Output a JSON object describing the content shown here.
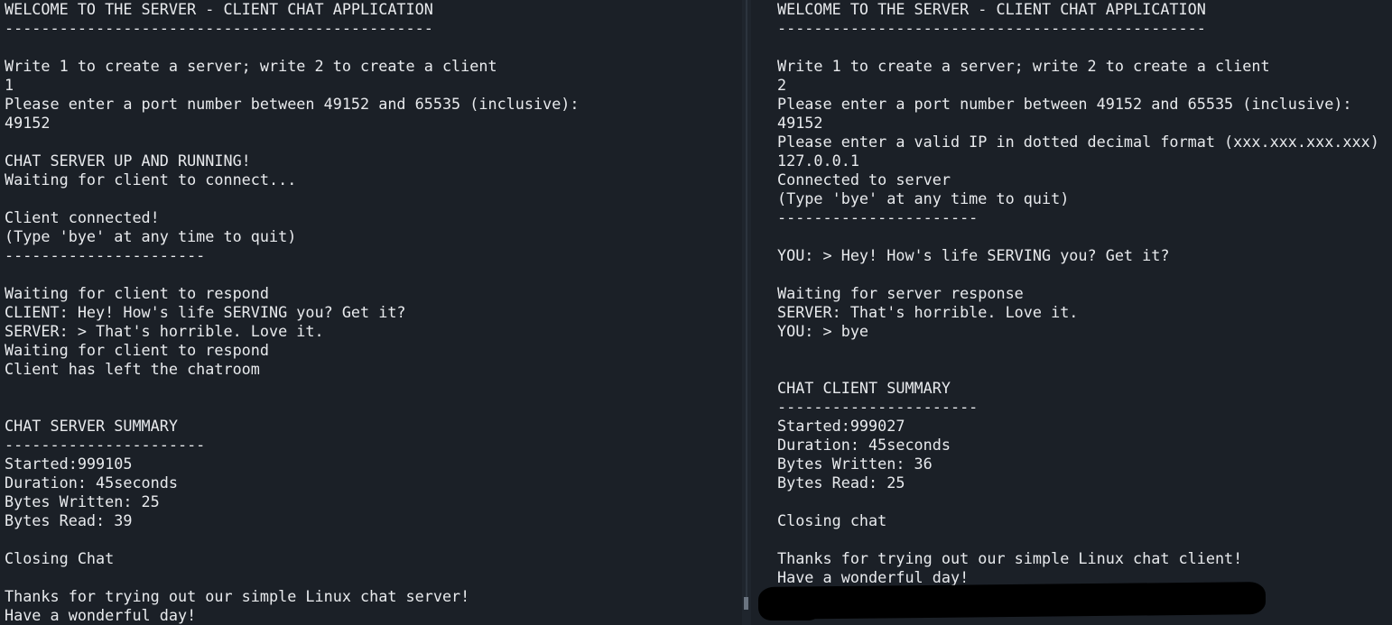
{
  "server_terminal": {
    "lines": [
      "WELCOME TO THE SERVER - CLIENT CHAT APPLICATION",
      "-----------------------------------------------",
      "",
      "Write 1 to create a server; write 2 to create a client",
      "1",
      "Please enter a port number between 49152 and 65535 (inclusive):",
      "49152",
      "",
      "CHAT SERVER UP AND RUNNING!",
      "Waiting for client to connect...",
      "",
      "Client connected!",
      "(Type 'bye' at any time to quit)",
      "----------------------",
      "",
      "Waiting for client to respond",
      "CLIENT: Hey! How's life SERVING you? Get it?",
      "SERVER: > That's horrible. Love it.",
      "Waiting for client to respond",
      "Client has left the chatroom",
      "",
      "",
      "CHAT SERVER SUMMARY",
      "----------------------",
      "Started:999105",
      "Duration: 45seconds",
      "Bytes Written: 25",
      "Bytes Read: 39",
      "",
      "Closing Chat",
      "",
      "Thanks for trying out our simple Linux chat server!",
      "Have a wonderful day!"
    ]
  },
  "client_terminal": {
    "lines": [
      "WELCOME TO THE SERVER - CLIENT CHAT APPLICATION",
      "-----------------------------------------------",
      "",
      "Write 1 to create a server; write 2 to create a client",
      "2",
      "Please enter a port number between 49152 and 65535 (inclusive):",
      "49152",
      "Please enter a valid IP in dotted decimal format (xxx.xxx.xxx.xxx)",
      "127.0.0.1",
      "Connected to server",
      "(Type 'bye' at any time to quit)",
      "----------------------",
      "",
      "YOU: > Hey! How's life SERVING you? Get it?",
      "",
      "Waiting for server response",
      "SERVER: That's horrible. Love it.",
      "YOU: > bye",
      "",
      "",
      "CHAT CLIENT SUMMARY",
      "----------------------",
      "Started:999027",
      "Duration: 45seconds",
      "Bytes Written: 36",
      "Bytes Read: 25",
      "",
      "Closing chat",
      "",
      "Thanks for trying out our simple Linux chat client!",
      "Have a wonderful day!"
    ]
  },
  "colors": {
    "background": "#1b2027",
    "text": "#e8eaed",
    "redaction": "#000000"
  }
}
